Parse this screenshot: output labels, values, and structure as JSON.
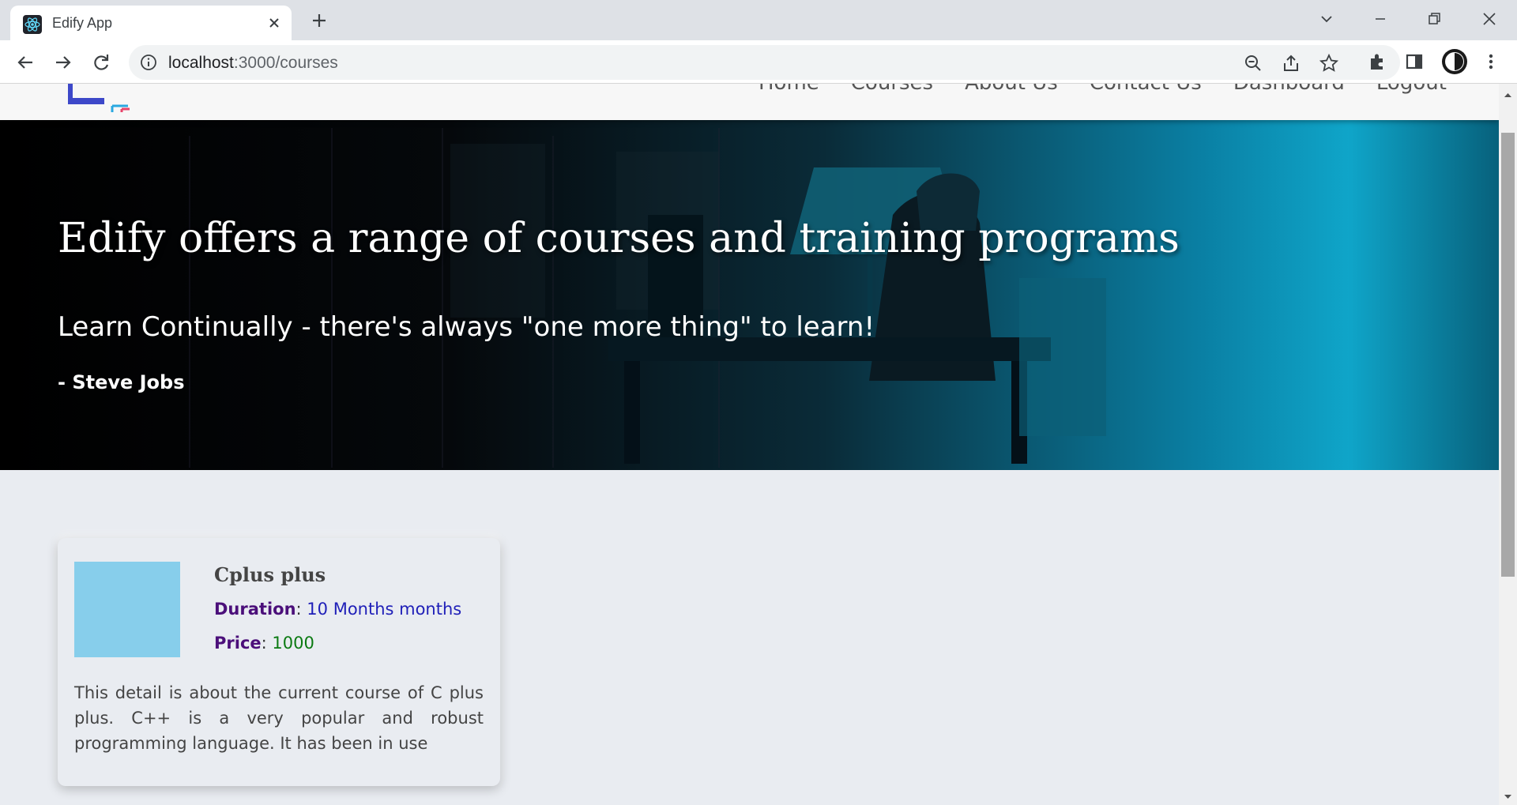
{
  "browser": {
    "tab_title": "Edify App",
    "url_host": "localhost",
    "url_path": ":3000/courses",
    "icons": [
      "react-favicon",
      "close-icon",
      "plus-icon",
      "chevron-down-icon",
      "minimize-icon",
      "restore-icon",
      "close-window-icon",
      "back-icon",
      "forward-icon",
      "reload-icon",
      "info-icon",
      "zoom-out-icon",
      "share-icon",
      "star-icon",
      "extensions-icon",
      "side-panel-icon",
      "profile-avatar",
      "menu-icon"
    ]
  },
  "navbar": {
    "links": [
      "Home",
      "Courses",
      "About Us",
      "Contact Us",
      "Dashboard",
      "Logout"
    ],
    "logo_colors": [
      "#3d48c9",
      "#e8456b",
      "#2aa8e0"
    ]
  },
  "hero": {
    "title": "Edify offers a range of courses and training programs",
    "quote": "Learn Continually - there's always \"one more thing\" to learn!",
    "author": "- Steve Jobs"
  },
  "courses": [
    {
      "name": "Cplus plus",
      "duration_label": "Duration",
      "duration": "10 Months months",
      "price_label": "Price",
      "price": "1000",
      "description": "This detail is about the current course of C plus plus. C++ is a very popular and robust programming language. It has been in use",
      "thumb_color": "#87ceeb"
    }
  ]
}
